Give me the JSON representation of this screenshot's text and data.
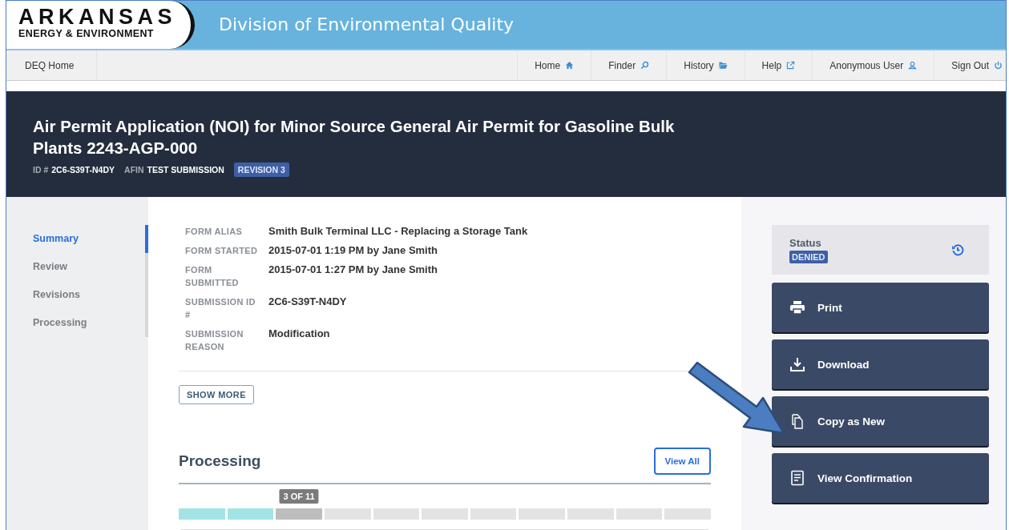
{
  "logo": {
    "name": "ARKANSAS",
    "subtitle": "ENERGY & ENVIRONMENT"
  },
  "header": {
    "title": "Division of Environmental Quality"
  },
  "nav": {
    "left": "DEQ Home",
    "items": [
      "Home",
      "Finder",
      "History",
      "Help",
      "Anonymous User",
      "Sign Out"
    ]
  },
  "banner": {
    "title": "Air Permit Application (NOI) for Minor Source General Air Permit for Gasoline Bulk Plants 2243-AGP-000",
    "id_label": "ID #",
    "id": "2C6-S39T-N4DY",
    "afin_label": "AFIN",
    "afin": "TEST SUBMISSION",
    "badge": "REVISION 3"
  },
  "sidebar": {
    "items": [
      {
        "label": "Summary",
        "selected": true
      },
      {
        "label": "Review",
        "selected": false
      },
      {
        "label": "Revisions",
        "selected": false
      },
      {
        "label": "Processing",
        "selected": false
      }
    ]
  },
  "details": [
    {
      "label": "FORM ALIAS",
      "value": "Smith Bulk Terminal LLC - Replacing a Storage Tank"
    },
    {
      "label": "FORM STARTED",
      "value": "2015-07-01 1:19 PM by Jane Smith"
    },
    {
      "label": "FORM SUBMITTED",
      "value": "2015-07-01 1:27 PM by Jane Smith"
    },
    {
      "label": "SUBMISSION ID #",
      "value": "2C6-S39T-N4DY"
    },
    {
      "label": "SUBMISSION REASON",
      "value": "Modification"
    }
  ],
  "show_more": "SHOW MORE",
  "processing": {
    "title": "Processing",
    "view_all": "View All",
    "step_label": "3 OF 11",
    "steps": [
      {
        "kind": "done"
      },
      {
        "kind": "done"
      },
      {
        "kind": "current"
      },
      {
        "kind": "pending"
      },
      {
        "kind": "pending"
      },
      {
        "kind": "pending"
      },
      {
        "kind": "pending"
      },
      {
        "kind": "pending"
      },
      {
        "kind": "pending"
      },
      {
        "kind": "pending"
      },
      {
        "kind": "pending"
      }
    ]
  },
  "status": {
    "label": "Status",
    "value": "DENIED"
  },
  "actions": [
    "Print",
    "Download",
    "Copy as New",
    "View Confirmation"
  ]
}
